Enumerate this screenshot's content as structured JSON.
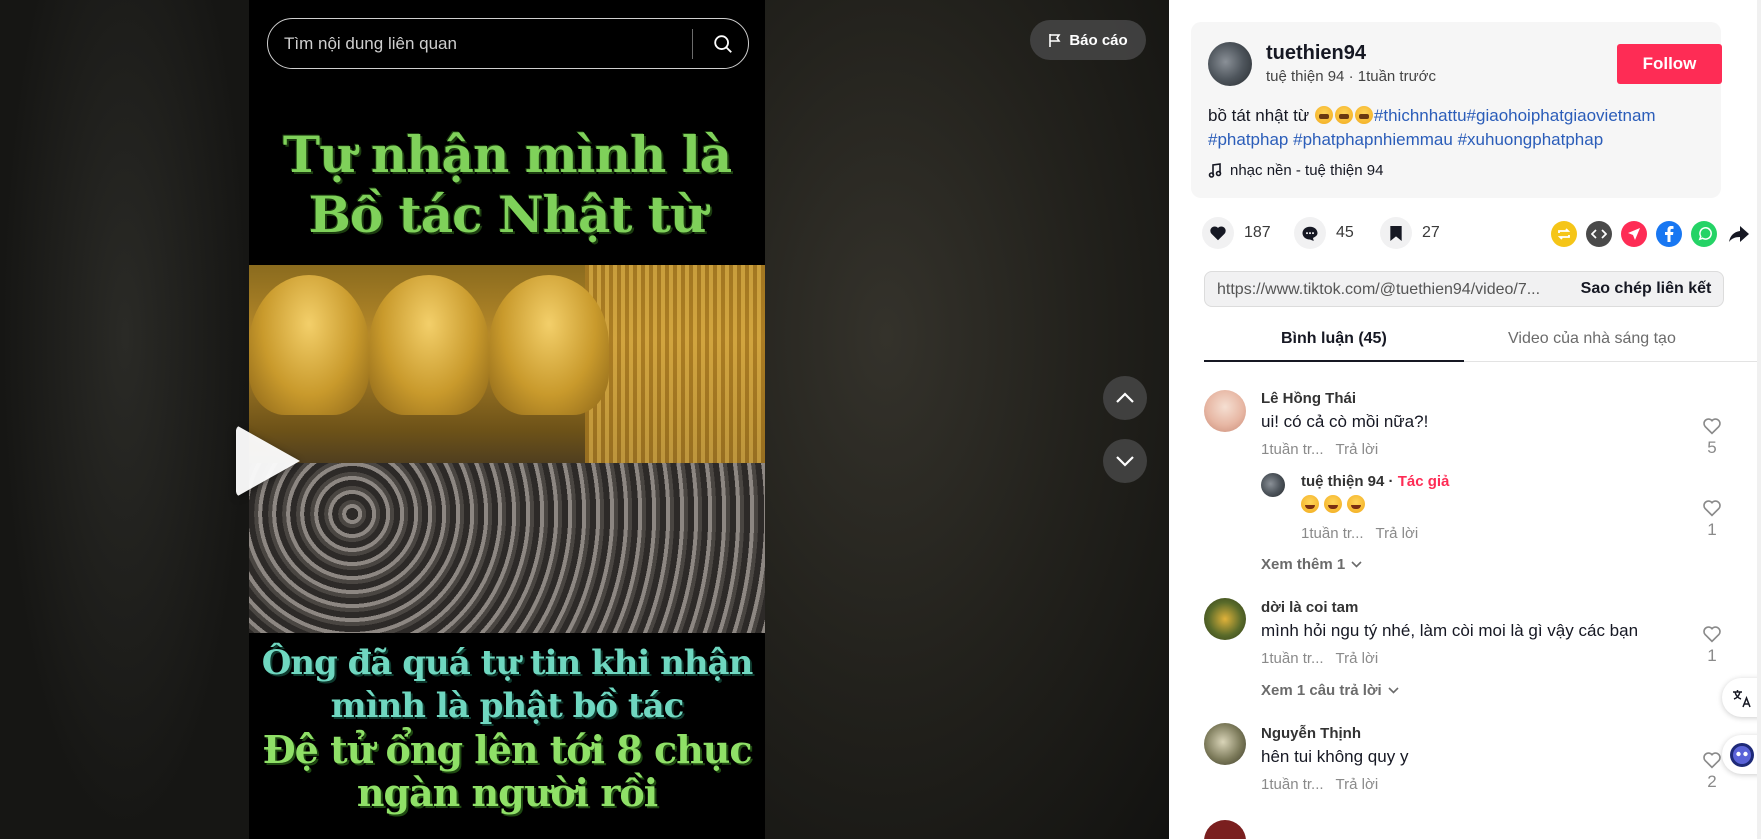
{
  "search": {
    "placeholder": "Tìm nội dung liên quan"
  },
  "report_label": "Báo cáo",
  "video": {
    "title_lines": [
      "Tự nhận mình là",
      "Bồ tác Nhật từ"
    ],
    "subtitle_lines": [
      "Ông đã quá tự tin khi nhận",
      "mình là phật bồ tác",
      "Đệ tử ổng lên tới 8 chục",
      "ngàn người rồi"
    ]
  },
  "author": {
    "username": "tuethien94",
    "subline": "tuệ thiện 94 · 1tuần trước",
    "follow_label": "Follow"
  },
  "description": {
    "text": "bồ tát nhật từ ",
    "tags": [
      "#thichnhattu",
      "#giaohoiphatgiaovietnam",
      "#phatphap",
      "#phatphapnhiemmau",
      "#xuhuongphatphap"
    ]
  },
  "music": "nhạc nền - tuệ thiện 94",
  "stats": {
    "likes": "187",
    "comments": "45",
    "saves": "27"
  },
  "share_icons": [
    "repost-icon",
    "embed-icon",
    "send-icon",
    "facebook-icon",
    "whatsapp-icon",
    "share-arrow-icon"
  ],
  "link": {
    "url": "https://www.tiktok.com/@tuethien94/video/7...",
    "copy_label": "Sao chép liên kết"
  },
  "tabs": {
    "comments": "Bình luận (45)",
    "creator_videos": "Video của nhà sáng tạo"
  },
  "comments": [
    {
      "name": "Lê Hồng Thái",
      "text": "ui! có cả cò mồi nữa?!",
      "time": "1tuần tr...",
      "reply": "Trả lời",
      "likes": "5"
    },
    {
      "name": "tuệ thiện 94",
      "author_tag": "Tác giả",
      "time": "1tuần tr...",
      "reply": "Trả lời",
      "likes": "1"
    },
    {
      "name": "dời là coi tam",
      "text": "mình hỏi ngu tý nhé, làm còi moi là gì vậy các bạn",
      "time": "1tuần tr...",
      "reply": "Trả lời",
      "likes": "1"
    },
    {
      "name": "Nguyễn Thịnh",
      "text": "hên tui không quy y",
      "time": "1tuần tr...",
      "reply": "Trả lời",
      "likes": "2"
    }
  ],
  "view_more": {
    "first": "Xem thêm 1",
    "second": "Xem 1 câu trả lời"
  },
  "colors": {
    "brand": "#fe2c55",
    "hashtag": "#2b5db9"
  }
}
